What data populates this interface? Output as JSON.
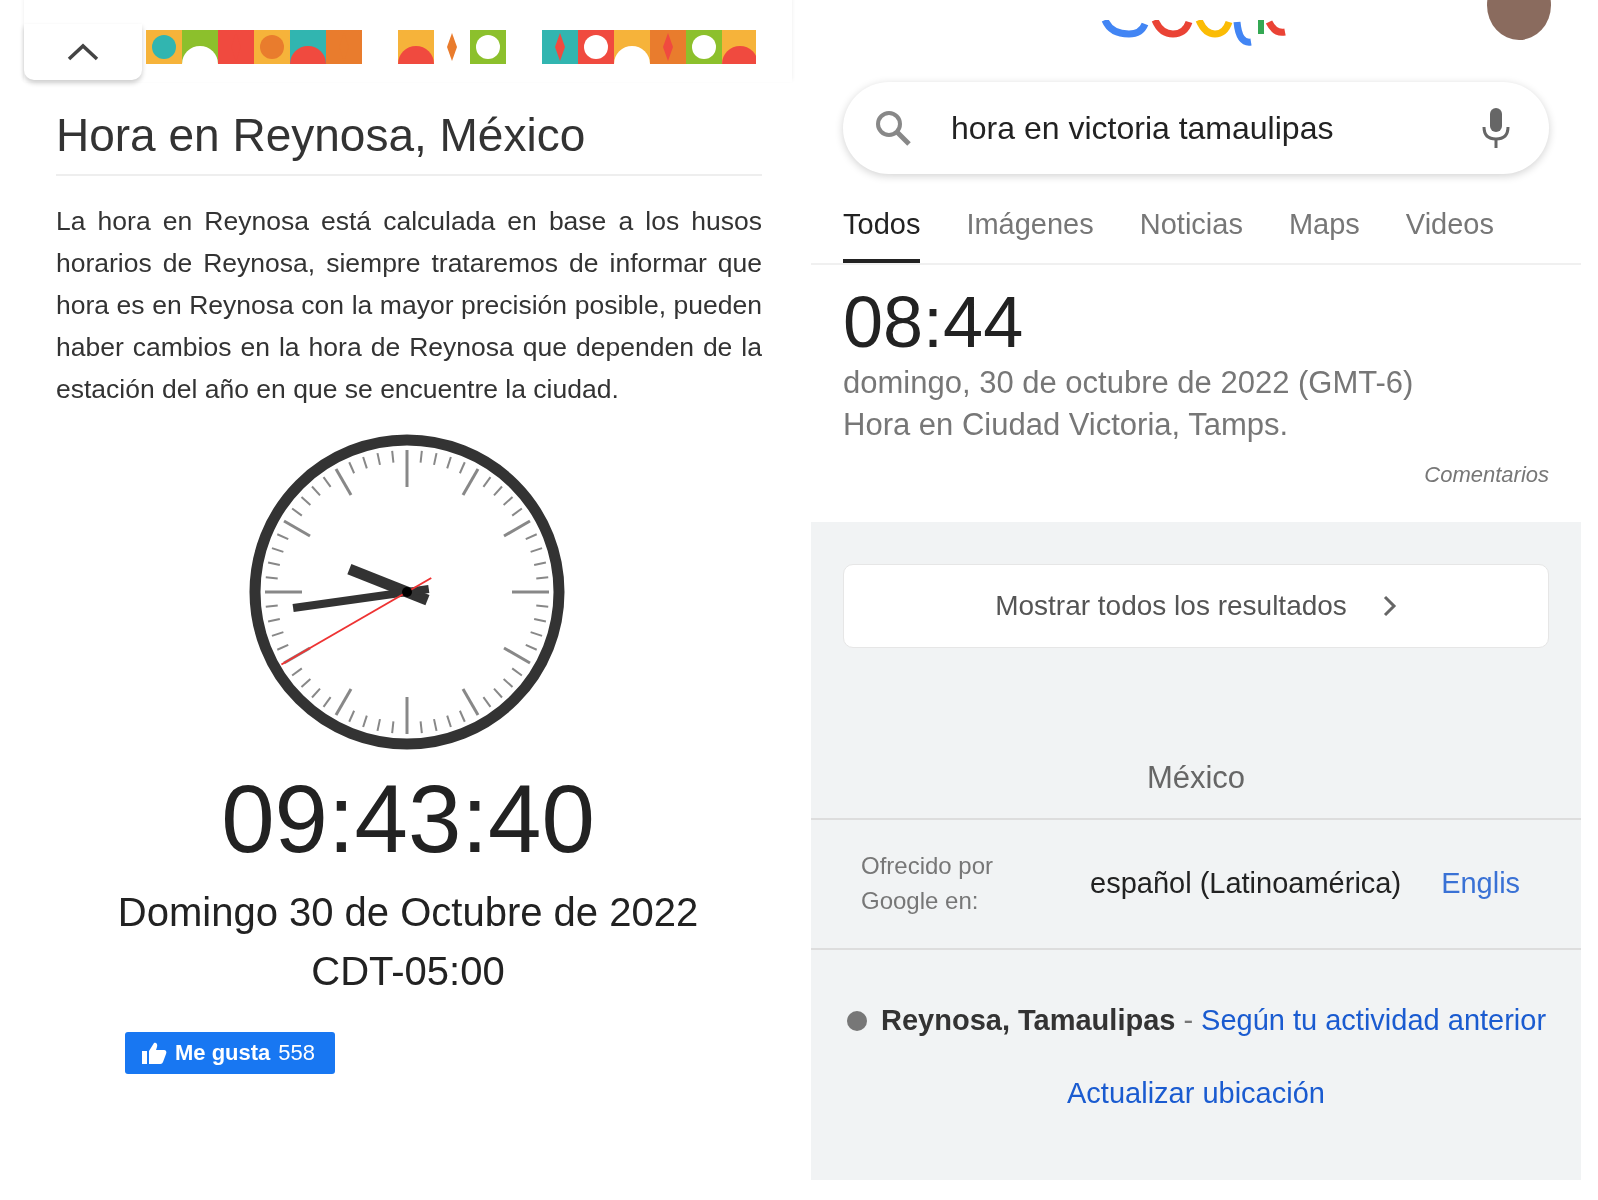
{
  "left": {
    "title": "Hora en Reynosa, México",
    "paragraph": "La hora en Reynosa está calculada en base a los husos horarios de Reynosa, siempre trataremos de informar que hora es en Reynosa con la mayor precisión posible, pueden haber cambios en la hora de Reynosa que dependen de la estación del año en que se encuentre la ciudad.",
    "time": "09:43:40",
    "date": "Domingo 30 de Octubre de 2022",
    "offset": "CDT-05:00",
    "like": {
      "label": "Me gusta",
      "count": "558"
    }
  },
  "right": {
    "search": {
      "value": "hora en victoria tamaulipas"
    },
    "tabs": [
      {
        "label": "Todos",
        "selected": true
      },
      {
        "label": "Imágenes",
        "selected": false
      },
      {
        "label": "Noticias",
        "selected": false
      },
      {
        "label": "Maps",
        "selected": false
      },
      {
        "label": "Videos",
        "selected": false
      }
    ],
    "time": "08:44",
    "date": "domingo, 30 de octubre de 2022 (GMT-6)",
    "place": "Hora en Ciudad Victoria, Tamps.",
    "feedback": "Comentarios",
    "show_all": "Mostrar todos los resultados",
    "region": "México",
    "language": {
      "label": "Ofrecido por Google en:",
      "current": "español (Latinoamérica)",
      "other": "Englis"
    },
    "location": {
      "place": "Reynosa, Tamaulipas",
      "separator": "-",
      "source": "Según tu actividad anterior",
      "update": "Actualizar ubicación"
    }
  }
}
